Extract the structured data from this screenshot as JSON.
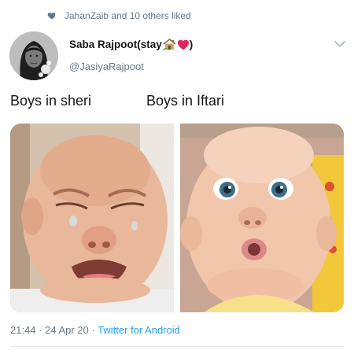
{
  "social_context": {
    "text": "JahanZaib and 10 others liked"
  },
  "author": {
    "display_name": "Saba Rajpoot(stay",
    "display_name_end": ")",
    "handle": "@JasiyaRajpoot"
  },
  "tweet": {
    "caption_left": "Boys in sheri",
    "caption_right": "Boys in Iftari"
  },
  "meta": {
    "time": "21:44",
    "sep1": " · ",
    "date": "24 Apr 20",
    "sep2": " · ",
    "source": "Twitter for Android"
  },
  "colors": {
    "text_primary": "#14171a",
    "text_secondary": "#657786",
    "link": "#1da1f2",
    "heart": "#e0245e"
  },
  "icons": {
    "social_context": "heart-icon",
    "name_emoji_1": "house-icon",
    "name_emoji_2": "red-heart-icon",
    "caret": "chevron-down-icon"
  }
}
